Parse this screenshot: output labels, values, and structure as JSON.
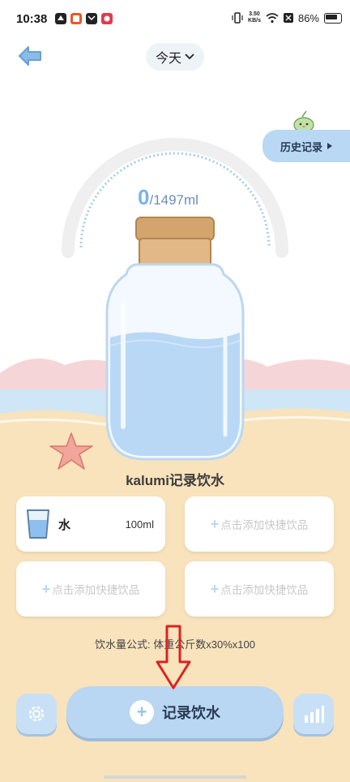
{
  "status_bar": {
    "time": "10:38",
    "net_speed_value": "3.50",
    "net_speed_unit": "KB/s",
    "battery": "86%"
  },
  "header": {
    "date_label": "今天"
  },
  "history": {
    "label": "历史记录"
  },
  "progress": {
    "current": "0",
    "goal": "/1497ml",
    "fill_fraction": 0
  },
  "app": {
    "title": "kalumi记录饮水"
  },
  "quick_drinks": [
    {
      "name": "水",
      "volume": "100ml"
    },
    {
      "add_label": "点击添加快捷饮品"
    },
    {
      "add_label": "点击添加快捷饮品"
    },
    {
      "add_label": "点击添加快捷饮品"
    }
  ],
  "formula": {
    "text": "饮水量公式: 体重公斤数x30%x100"
  },
  "bottom": {
    "record_label": "记录饮水"
  },
  "colors": {
    "accent_blue": "#b9d6f2",
    "sand": "#f8e3bd",
    "annotation_arrow": "#e02020"
  },
  "icons": [
    "back-arrow-icon",
    "chevron-down-icon",
    "play-triangle-icon",
    "gear-icon",
    "bar-chart-icon",
    "plus-icon",
    "water-glass-icon"
  ]
}
